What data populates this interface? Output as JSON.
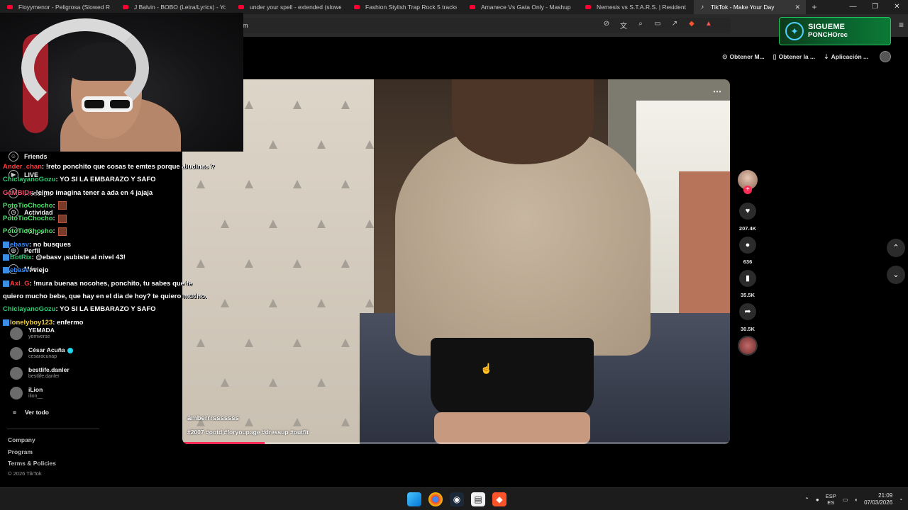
{
  "browser": {
    "tabs": [
      {
        "label": "Floyymenor - Peligrosa (Slowed Rev",
        "type": "youtube"
      },
      {
        "label": "J Balvin - BOBO (Letra/Lyrics) - YouT",
        "type": "youtube"
      },
      {
        "label": "under your spell - extended (slowed",
        "type": "youtube"
      },
      {
        "label": "Fashion Stylish Trap Rock 5 tracks by",
        "type": "youtube"
      },
      {
        "label": "Amanece Vs Gata Only - Mashup - Y",
        "type": "youtube"
      },
      {
        "label": "Nemesis vs S.T.A.R.S. | Resident Evil 3",
        "type": "youtube"
      },
      {
        "label": "TikTok - Make Your Day",
        "type": "tiktok",
        "active": true
      }
    ],
    "new_tab": "+",
    "address_text": "m",
    "window_controls": [
      "—",
      "❐",
      "✕"
    ]
  },
  "overlay": {
    "twitter_line1": "SIGUEME",
    "twitter_line2": "PONCHOrec"
  },
  "topbar": {
    "get_coins": "Obtener M...",
    "get_app": "Obtener la ...",
    "app": "Aplicación ..."
  },
  "chat": [
    {
      "user": "Ander_chan",
      "color": "#ff3b3b",
      "text": ": !reto ponchito que cosas te emtes porque alucinas ?"
    },
    {
      "user": "ChiclayanoGozu",
      "color": "#2ecc71",
      "text": ": YO SI LA EMBARAZO Y SAFO"
    },
    {
      "user": "GaMBlDr",
      "color": "#ff4f6e",
      "text": ": !elmo imagina tener a ada en 4 jajaja"
    },
    {
      "user": "PotoTioChocho",
      "color": "#4de36b",
      "text": ":",
      "emote": true
    },
    {
      "user": "PotoTioChocho",
      "color": "#4de36b",
      "text": ":",
      "emote": true
    },
    {
      "user": "PotoTioChocho",
      "color": "#4de36b",
      "text": ":",
      "emote": true
    },
    {
      "user": "ebasv",
      "color": "#2f8bff",
      "text": ": no busques",
      "badge": true
    },
    {
      "user": "BotRix",
      "color": "#2ecc71",
      "text": ": @ebasv ¡subiste al nivel 43!",
      "badge": true
    },
    {
      "user": "ebasv",
      "color": "#2f8bff",
      "text": ": viejo",
      "badge": true
    },
    {
      "user": "Axl_G",
      "color": "#ff3b3b",
      "text": ": !mura buenas nocohes, ponchito, tu sabes que te",
      "badge": true
    },
    {
      "user": "",
      "color": "#fff",
      "text": "quiero mucho bebe, que hay en el dia de hoy? te quiero mucho."
    },
    {
      "user": "ChiclayanoGozu",
      "color": "#2ecc71",
      "text": ": YO SI LA EMBARAZO Y SAFO"
    },
    {
      "user": "lonelyboy123",
      "color": "#f4d03f",
      "text": ": enfermo",
      "badge": true
    }
  ],
  "sidebar": {
    "nav": [
      {
        "label": "Friends"
      },
      {
        "label": "LIVE"
      },
      {
        "label": "Mensajes"
      },
      {
        "label": "Actividad"
      },
      {
        "label": "Cargar"
      },
      {
        "label": "Perfil"
      },
      {
        "label": "Más"
      }
    ],
    "accounts": [
      {
        "name": "YEMADA",
        "handle": "yemverse",
        "verified": false
      },
      {
        "name": "César Acuña",
        "handle": "cesaracunap",
        "verified": true
      },
      {
        "name": "bestlife.danler",
        "handle": "bestlife.danler",
        "verified": false
      },
      {
        "name": "iLion",
        "handle": "ilion__",
        "verified": false
      }
    ],
    "see_all": "Ver todo",
    "footer": [
      "Company",
      "Program",
      "Terms & Policies"
    ],
    "copyright": "© 2026 TikTok"
  },
  "video": {
    "username": "amberrrsssssss",
    "hashtags": "#2007 #ootd #foryoupage #dressup #outfit",
    "progress": 0.15
  },
  "actions": {
    "likes": "207.4K",
    "comments": "636",
    "saves": "35.5K",
    "shares": "30.5K"
  },
  "taskbar": {
    "lang1": "ESP",
    "lang2": "ES",
    "time": "21:09",
    "date": "07/03/2026"
  }
}
